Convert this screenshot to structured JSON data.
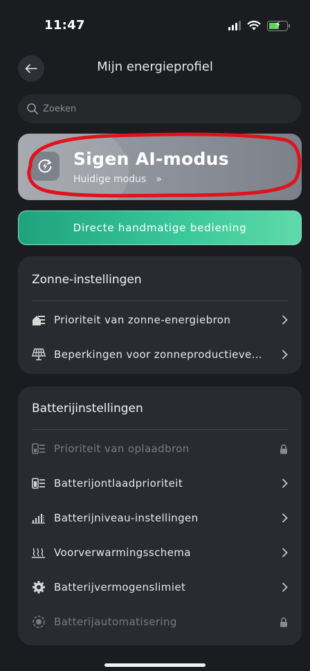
{
  "status_bar": {
    "time": "11:47"
  },
  "header": {
    "title": "Mijn energieprofiel"
  },
  "search": {
    "placeholder": "Zoeken"
  },
  "ai_mode": {
    "title": "Sigen AI-modus",
    "subtitle": "Huidige modus",
    "chevron": "»",
    "highlight_color": "#e0121c"
  },
  "manual_button": {
    "label": "Directe handmatige bediening"
  },
  "solar_settings": {
    "title": "Zonne-instellingen",
    "items": [
      {
        "label": "Prioriteit van zonne-energiebron",
        "icon": "house-priority-icon"
      },
      {
        "label": "Beperkingen voor zonneproductieve…",
        "icon": "solar-panel-icon"
      }
    ]
  },
  "battery_settings": {
    "title": "Batterijinstellingen",
    "items": [
      {
        "label": "Prioriteit van oplaadbron",
        "icon": "charge-source-icon",
        "locked": true
      },
      {
        "label": "Batterijontlaadprioriteit",
        "icon": "discharge-priority-icon",
        "locked": false
      },
      {
        "label": "Batterijniveau-instellingen",
        "icon": "battery-level-icon",
        "locked": false
      },
      {
        "label": "Voorverwarmingsschema",
        "icon": "preheat-icon",
        "locked": false
      },
      {
        "label": "Batterijvermogenslimiet",
        "icon": "gear-icon",
        "locked": false
      },
      {
        "label": "Batterijautomatisering",
        "icon": "automation-icon",
        "locked": true
      }
    ]
  },
  "colors": {
    "accent_green": "#3cc99a",
    "background": "#1b1c20",
    "card": "#2a2b30"
  }
}
